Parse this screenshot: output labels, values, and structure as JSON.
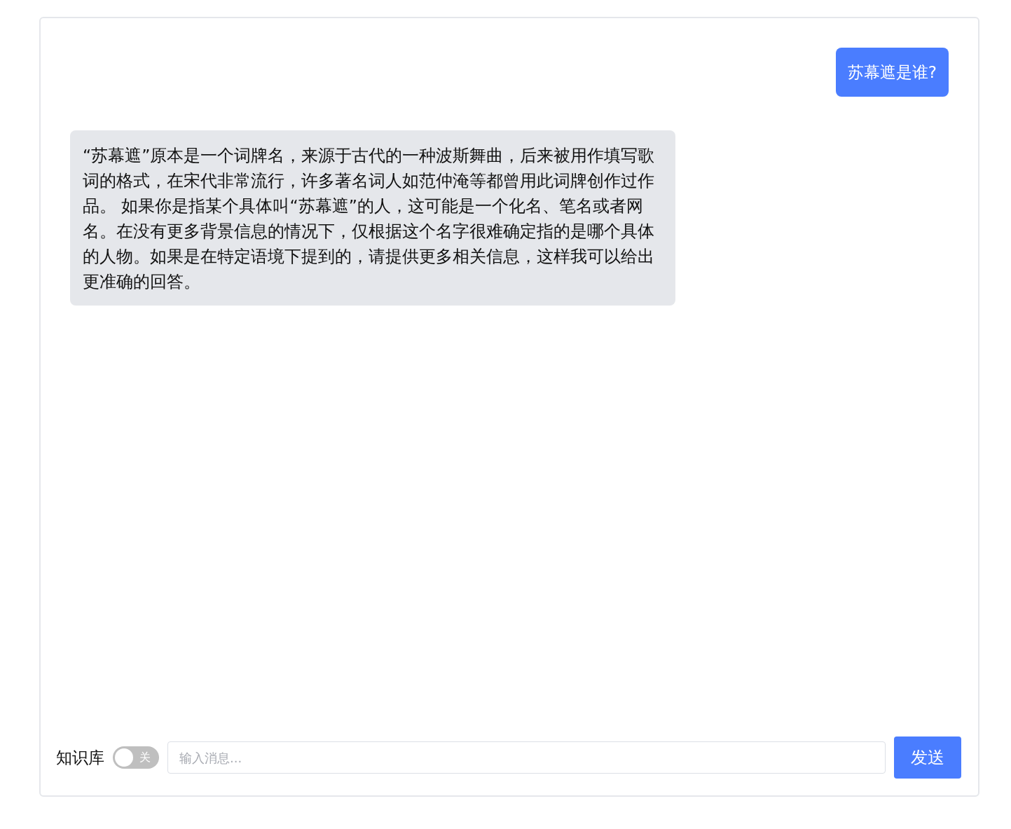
{
  "messages": [
    {
      "kind": "user",
      "text": "苏幕遮是谁?"
    },
    {
      "kind": "assistant",
      "text": "“苏幕遮”原本是一个词牌名，来源于古代的一种波斯舞曲，后来被用作填写歌词的格式，在宋代非常流行，许多著名词人如范仲淹等都曾用此词牌创作过作品。 如果你是指某个具体叫“苏幕遮”的人，这可能是一个化名、笔名或者网名。在没有更多背景信息的情况下，仅根据这个名字很难确定指的是哪个具体的人物。如果是在特定语境下提到的，请提供更多相关信息，这样我可以给出更准确的回答。"
    }
  ],
  "composer": {
    "knowledge_label": "知识库",
    "knowledge_switch": {
      "on": false,
      "text": "关"
    },
    "input": {
      "placeholder": "输入消息..."
    },
    "send_button": "发送"
  }
}
